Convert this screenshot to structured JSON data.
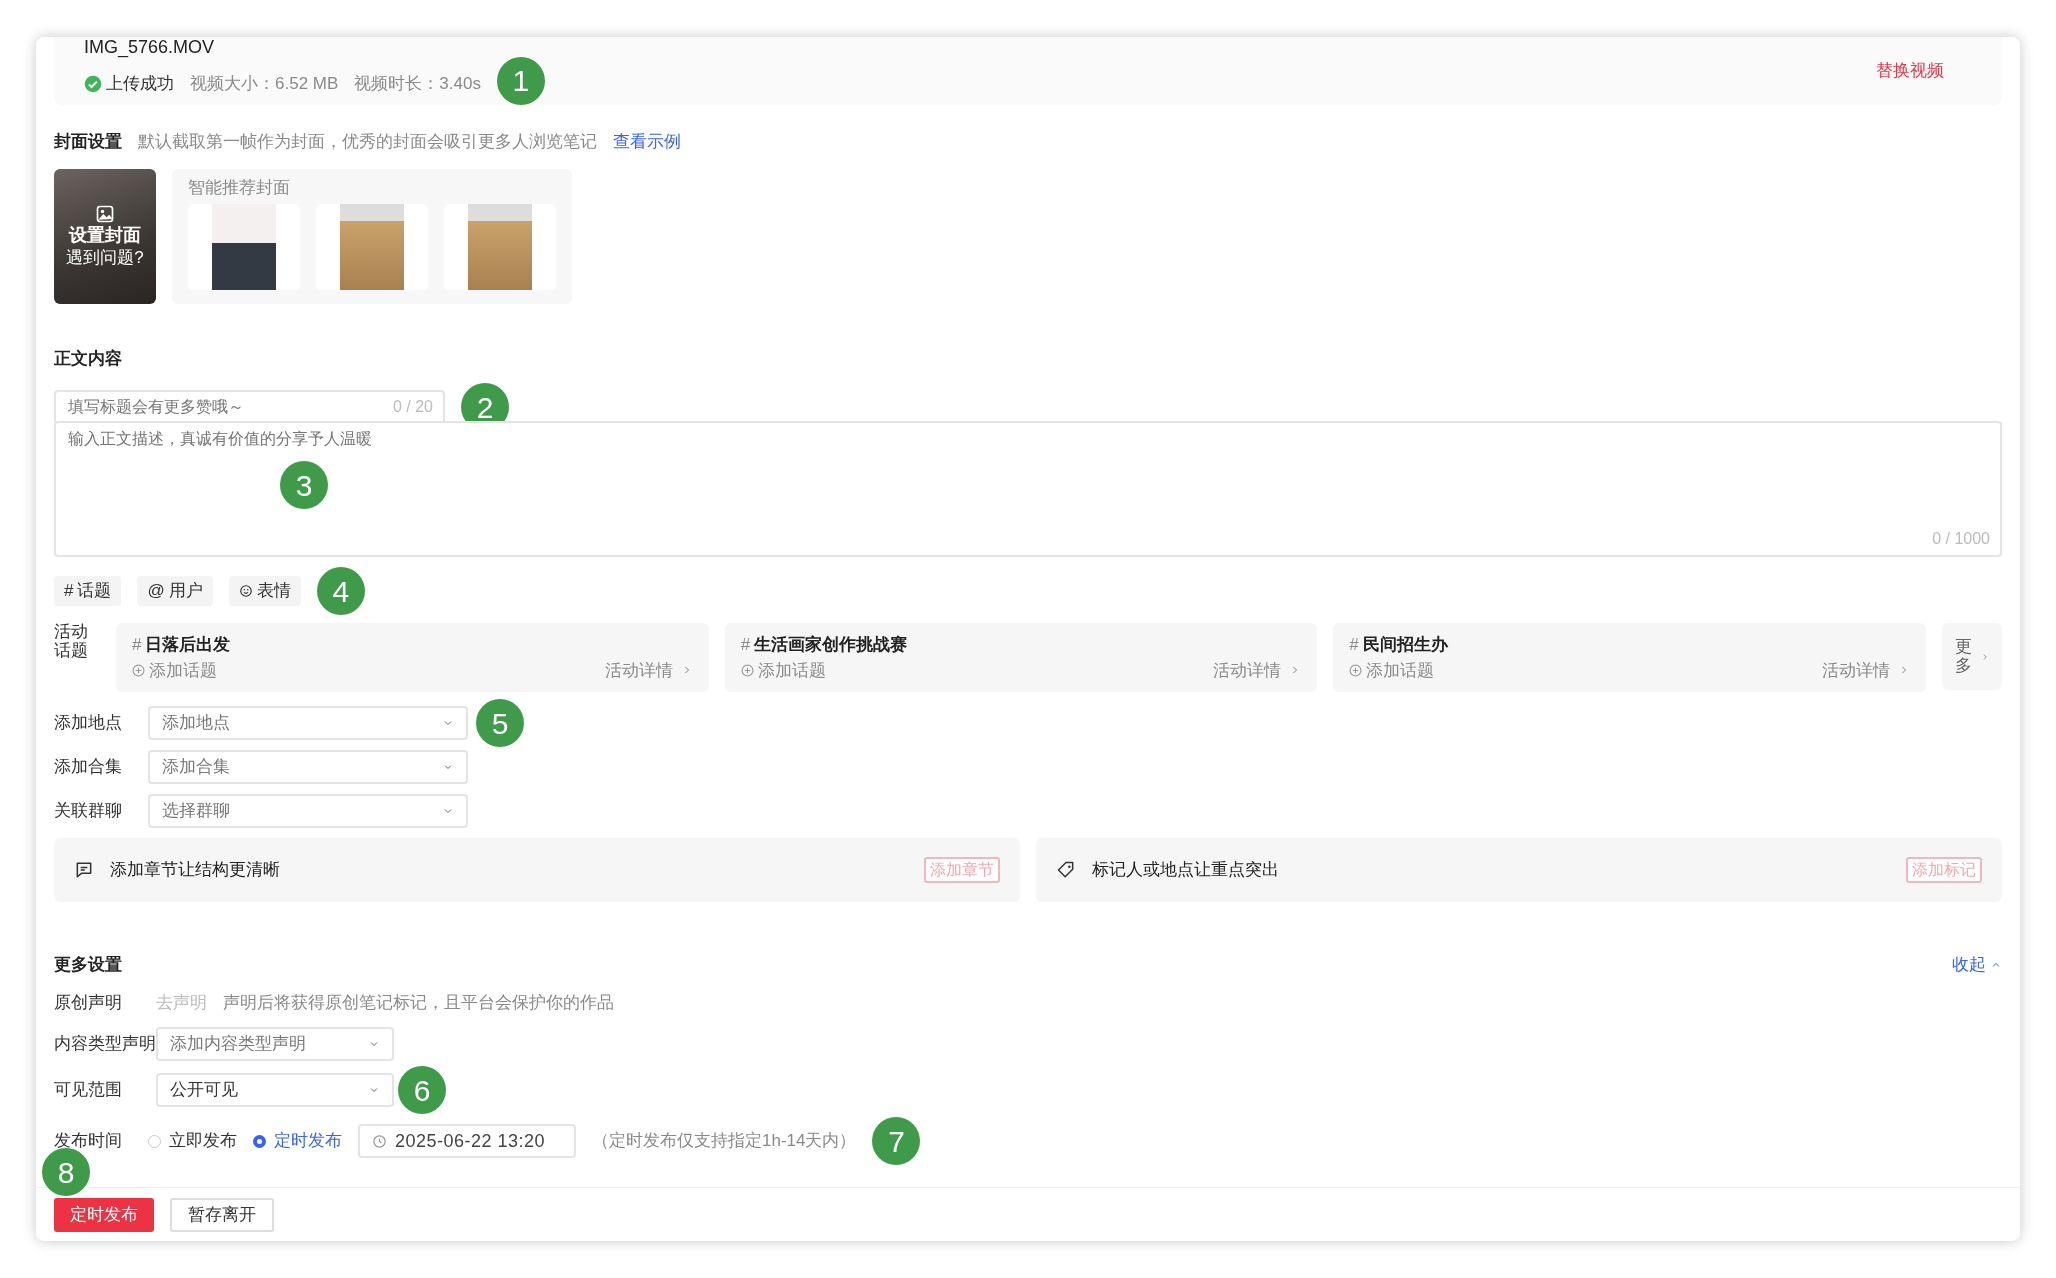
{
  "video": {
    "filename": "IMG_5766.MOV",
    "status": "上传成功",
    "size": "视频大小：6.52 MB",
    "duration": "视频时长：3.40s",
    "replace": "替换视频"
  },
  "cover": {
    "label": "封面设置",
    "hint": "默认截取第一帧作为封面，优秀的封面会吸引更多人浏览笔记",
    "link": "查看示例",
    "set_label": "设置封面",
    "help": "遇到问题?",
    "recommend_title": "智能推荐封面",
    "thumbnails": [
      {
        "kind": "laptop"
      },
      {
        "kind": "table"
      },
      {
        "kind": "table"
      }
    ]
  },
  "content": {
    "label": "正文内容",
    "title_placeholder": "填写标题会有更多赞哦～",
    "title_count": "0 / 20",
    "body_placeholder": "输入正文描述，真诚有价值的分享予人温暖",
    "body_count": "0 / 1000"
  },
  "insert_buttons": [
    {
      "kind": "symbol",
      "symbol": "#",
      "label": "话题"
    },
    {
      "kind": "symbol",
      "symbol": "@",
      "label": "用户"
    },
    {
      "kind": "smiley",
      "label": "表情"
    }
  ],
  "activity": {
    "label": "活动话题",
    "topics": [
      {
        "hash": "#",
        "name": "日落后出发",
        "action": "添加话题",
        "detail": "活动详情"
      },
      {
        "hash": "#",
        "name": "生活画家创作挑战赛",
        "action": "添加话题",
        "detail": "活动详情"
      },
      {
        "hash": "#",
        "name": "民间招生办",
        "action": "添加话题",
        "detail": "活动详情"
      }
    ],
    "more": "更多"
  },
  "selects": [
    {
      "label": "添加地点",
      "placeholder": "添加地点"
    },
    {
      "label": "添加合集",
      "placeholder": "添加合集"
    },
    {
      "label": "关联群聊",
      "placeholder": "选择群聊"
    }
  ],
  "feature_panels": [
    {
      "kind": "chapter",
      "text": "添加章节让结构更清晰",
      "button": "添加章节"
    },
    {
      "kind": "tag",
      "text": "标记人或地点让重点突出",
      "button": "添加标记"
    }
  ],
  "more_settings": {
    "title": "更多设置",
    "collapse": "收起",
    "original": {
      "label": "原创声明",
      "action": "去声明",
      "hint": "声明后将获得原创笔记标记，且平台会保护你的作品"
    },
    "content_type": {
      "label": "内容类型声明",
      "placeholder": "添加内容类型声明"
    },
    "visibility": {
      "label": "可见范围",
      "value": "公开可见"
    },
    "publish_time": {
      "label": "发布时间",
      "options": [
        {
          "label": "立即发布",
          "selected": false
        },
        {
          "label": "定时发布",
          "selected": true
        }
      ],
      "datetime": "2025-06-22 13:20",
      "note": "（定时发布仅支持指定1h-14天内）"
    }
  },
  "actions": [
    {
      "kind": "primary",
      "label": "定时发布"
    },
    {
      "kind": "secondary",
      "label": "暂存离开"
    }
  ],
  "callouts": [
    "1",
    "2",
    "3",
    "4",
    "5",
    "6",
    "7",
    "8"
  ]
}
